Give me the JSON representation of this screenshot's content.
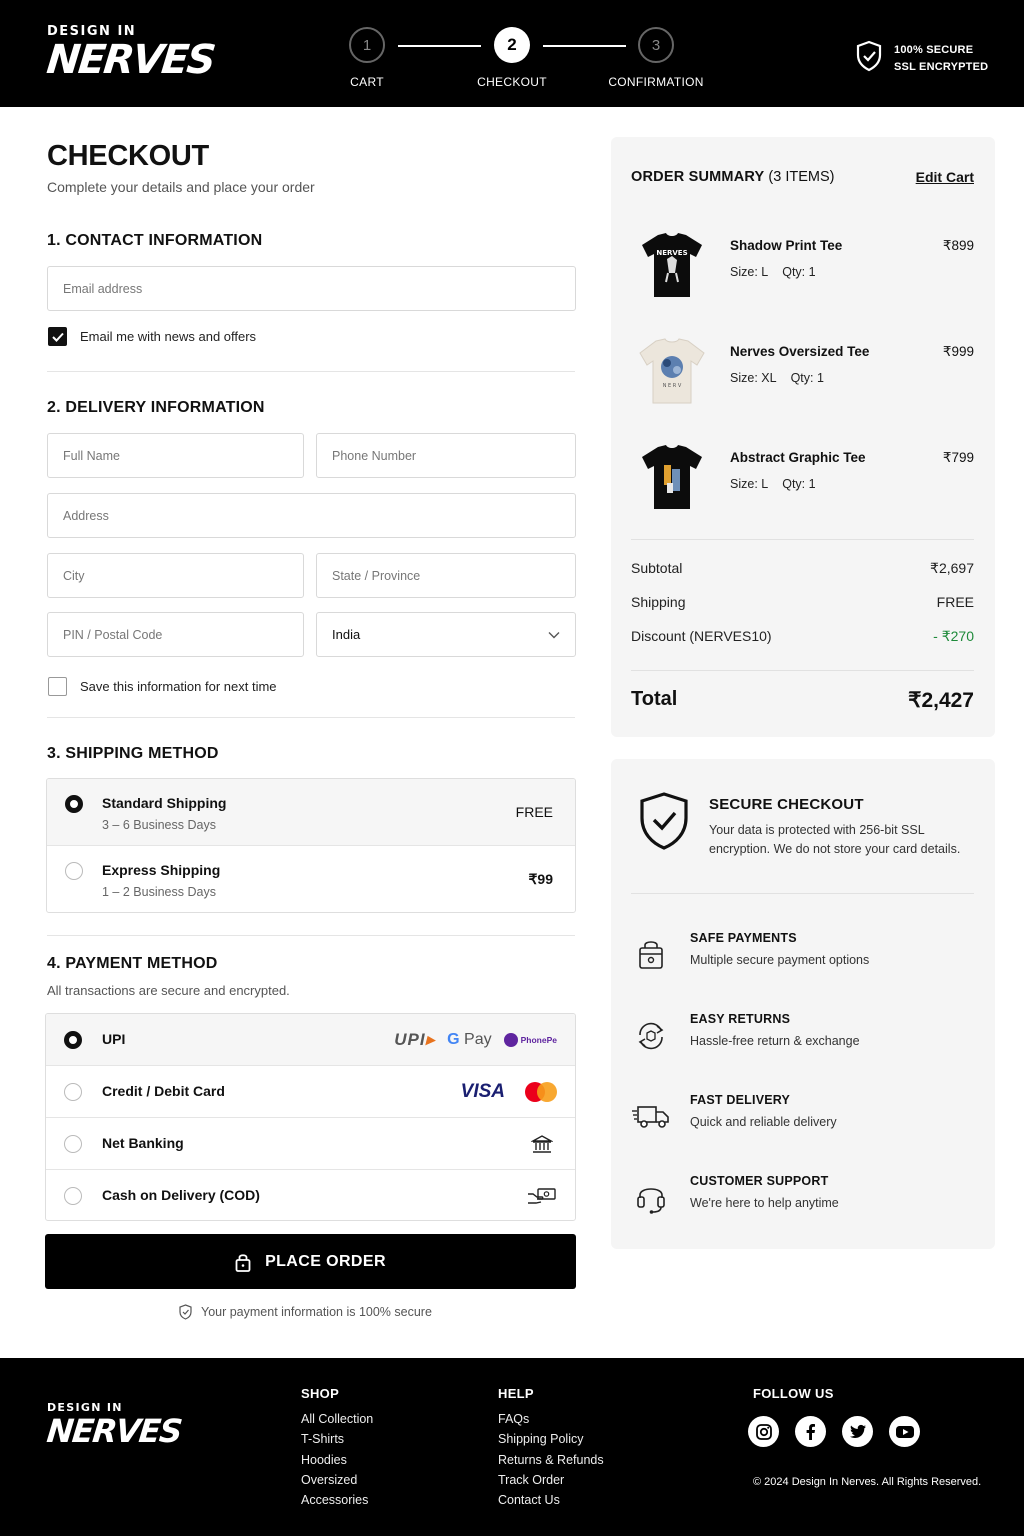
{
  "brand": {
    "top": "DESIGN IN",
    "main": "NERVES"
  },
  "steps": [
    {
      "num": "1",
      "label": "CART"
    },
    {
      "num": "2",
      "label": "CHECKOUT"
    },
    {
      "num": "3",
      "label": "CONFIRMATION"
    }
  ],
  "secure_badge": {
    "line1": "100% SECURE",
    "line2": "SSL ENCRYPTED"
  },
  "page": {
    "title": "CHECKOUT",
    "subtitle": "Complete your details and place your order"
  },
  "contact": {
    "heading": "1. CONTACT INFORMATION",
    "email_placeholder": "Email address",
    "newsletter_label": "Email me with news and offers",
    "newsletter_checked": true
  },
  "delivery": {
    "heading": "2. DELIVERY INFORMATION",
    "full_name_placeholder": "Full Name",
    "phone_placeholder": "Phone Number",
    "address_placeholder": "Address",
    "city_placeholder": "City",
    "state_placeholder": "State / Province",
    "pin_placeholder": "PIN / Postal Code",
    "country": "India",
    "save_label": "Save this information for next time"
  },
  "shipping": {
    "heading": "3. SHIPPING METHOD",
    "options": [
      {
        "name": "Standard Shipping",
        "days": "3 – 6 Business Days",
        "price": "FREE",
        "selected": true
      },
      {
        "name": "Express Shipping",
        "days": "1 – 2 Business Days",
        "price": "₹99",
        "selected": false
      }
    ]
  },
  "payment": {
    "heading": "4. PAYMENT METHOD",
    "subtitle": "All transactions are secure and encrypted.",
    "options": [
      {
        "name": "UPI",
        "selected": true
      },
      {
        "name": "Credit / Debit Card",
        "selected": false
      },
      {
        "name": "Net Banking",
        "selected": false
      },
      {
        "name": "Cash on Delivery (COD)",
        "selected": false
      }
    ],
    "upi_logos": {
      "upi": "UPI",
      "gpay_g": "G",
      "gpay": "Pay",
      "phonepe": "PhonePe"
    },
    "card_logos": {
      "visa": "VISA"
    }
  },
  "place_order": {
    "label": "PLACE ORDER",
    "note": "Your payment information is 100% secure"
  },
  "summary": {
    "heading": "ORDER SUMMARY",
    "count": "(3 ITEMS)",
    "edit": "Edit Cart",
    "items": [
      {
        "name": "Shadow Print Tee",
        "size": "Size:  L",
        "qty": "Qty:  1",
        "price": "₹899",
        "color": "#0c0c0c"
      },
      {
        "name": "Nerves Oversized Tee",
        "size": "Size:  XL",
        "qty": "Qty:  1",
        "price": "₹999",
        "color": "#ece6dc"
      },
      {
        "name": "Abstract Graphic Tee",
        "size": "Size:  L",
        "qty": "Qty:  1",
        "price": "₹799",
        "color": "#0c0c0c"
      }
    ],
    "subtotal_label": "Subtotal",
    "subtotal": "₹2,697",
    "shipping_label": "Shipping",
    "shipping": "FREE",
    "discount_label": "Discount (NERVES10)",
    "discount": "- ₹270",
    "total_label": "Total",
    "total": "₹2,427"
  },
  "trust": {
    "title": "SECURE CHECKOUT",
    "desc": "Your data is protected with 256-bit SSL encryption. We do not store your card details.",
    "features": [
      {
        "title": "SAFE PAYMENTS",
        "desc": "Multiple secure payment options",
        "icon": "lock-bag-icon"
      },
      {
        "title": "EASY RETURNS",
        "desc": "Hassle-free return & exchange",
        "icon": "return-icon"
      },
      {
        "title": "FAST DELIVERY",
        "desc": "Quick and reliable delivery",
        "icon": "truck-icon"
      },
      {
        "title": "CUSTOMER SUPPORT",
        "desc": "We're here to help anytime",
        "icon": "headset-icon"
      }
    ]
  },
  "footer": {
    "shop_heading": "SHOP",
    "shop_links": [
      "All Collection",
      "T-Shirts",
      "Hoodies",
      "Oversized",
      "Accessories"
    ],
    "help_heading": "HELP",
    "help_links": [
      "FAQs",
      "Shipping Policy",
      "Returns & Refunds",
      "Track Order",
      "Contact Us"
    ],
    "follow_heading": "FOLLOW US",
    "copyright": "© 2024 Design In Nerves. All Rights Reserved."
  },
  "colors": {
    "accent": "#000000",
    "discount": "#1e8a3a",
    "panel": "#f5f5f5"
  }
}
